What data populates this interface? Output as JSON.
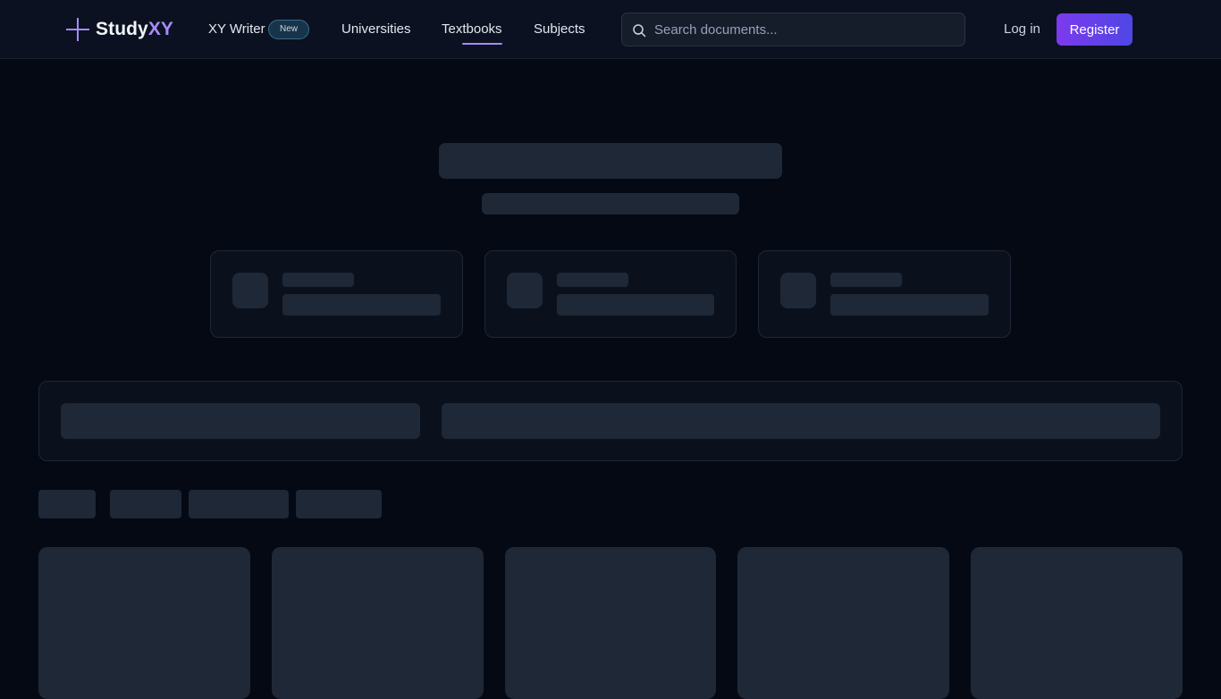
{
  "brand": {
    "name_main": "Study",
    "name_accent": "XY",
    "accent_color": "#a78bfa",
    "icon": "plus-logo-icon"
  },
  "nav": {
    "writer_label": "XY Writer",
    "writer_badge": "New",
    "items": [
      {
        "label": "Universities"
      },
      {
        "label": "Textbooks",
        "active": true
      },
      {
        "label": "Subjects"
      }
    ]
  },
  "search": {
    "placeholder": "Search documents...",
    "value": "",
    "icon": "search-icon"
  },
  "auth": {
    "login_label": "Log in",
    "register_label": "Register",
    "register_gradient": [
      "#7c3aed",
      "#4f46e5"
    ]
  },
  "colors": {
    "background": "#050914",
    "header": "#0b1120",
    "skeleton": "#1f2837",
    "card": "#0b111c"
  },
  "state": "loading-skeleton"
}
